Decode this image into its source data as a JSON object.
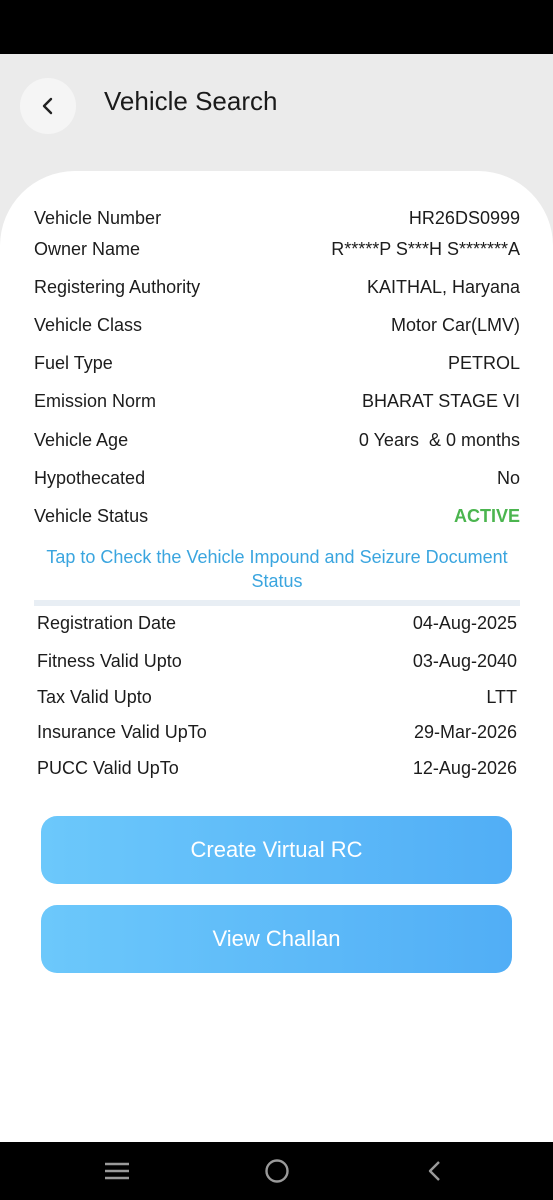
{
  "header": {
    "title": "Vehicle Search"
  },
  "details": [
    {
      "label": "Vehicle Number",
      "value": "HR26DS0999"
    },
    {
      "label": "Owner Name",
      "value": "R*****P S***H S*******A"
    },
    {
      "label": "Registering Authority",
      "value": "KAITHAL, Haryana"
    },
    {
      "label": "Vehicle Class",
      "value": "Motor Car(LMV)"
    },
    {
      "label": "Fuel Type",
      "value": "PETROL"
    },
    {
      "label": "Emission Norm",
      "value": "BHARAT STAGE VI"
    },
    {
      "label": "Vehicle Age",
      "value": "0 Years  & 0 months"
    },
    {
      "label": "Hypothecated",
      "value": "No"
    },
    {
      "label": "Vehicle Status",
      "value": "ACTIVE"
    }
  ],
  "impound_link": "Tap to Check the Vehicle Impound and Seizure Document Status",
  "validity": [
    {
      "label": "Registration Date",
      "value": "04-Aug-2025"
    },
    {
      "label": "Fitness Valid Upto",
      "value": "03-Aug-2040"
    },
    {
      "label": "Tax Valid Upto",
      "value": "LTT"
    },
    {
      "label": "Insurance Valid UpTo",
      "value": "29-Mar-2026"
    },
    {
      "label": "PUCC Valid UpTo",
      "value": "12-Aug-2026"
    }
  ],
  "buttons": {
    "virtual_rc": "Create Virtual RC",
    "challan": "View Challan"
  },
  "colors": {
    "active": "#4bb54f",
    "link": "#3aa5df",
    "button_start": "#6cc8fb",
    "button_end": "#51aef6"
  },
  "icons": {
    "back": "chevron-left-icon",
    "nav_recent": "menu-lines-icon",
    "nav_home": "circle-home-icon",
    "nav_back": "chevron-left-icon"
  }
}
